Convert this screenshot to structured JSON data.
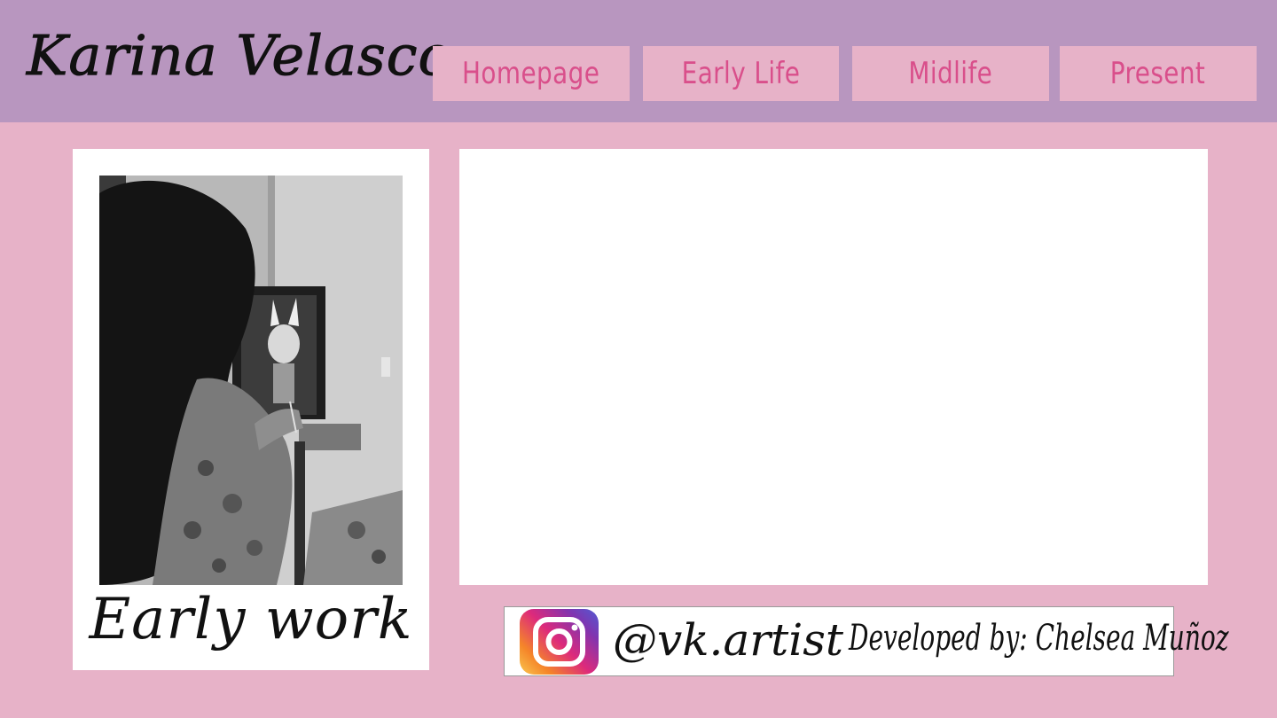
{
  "header": {
    "title": "Karina Velasco",
    "nav": [
      {
        "label": "Homepage"
      },
      {
        "label": "Early Life"
      },
      {
        "label": "Midlife"
      },
      {
        "label": "Present"
      }
    ]
  },
  "photo_card": {
    "caption": "Early work"
  },
  "footer": {
    "instagram_handle": "@vk.artist",
    "developer_credit": "Developed by: Chelsea Muñoz"
  },
  "colors": {
    "page_background": "#e7b2c8",
    "header_background": "#b896bf",
    "nav_text": "#d94f8b",
    "card_background": "#ffffff"
  },
  "icons": {
    "social": "instagram-icon"
  }
}
